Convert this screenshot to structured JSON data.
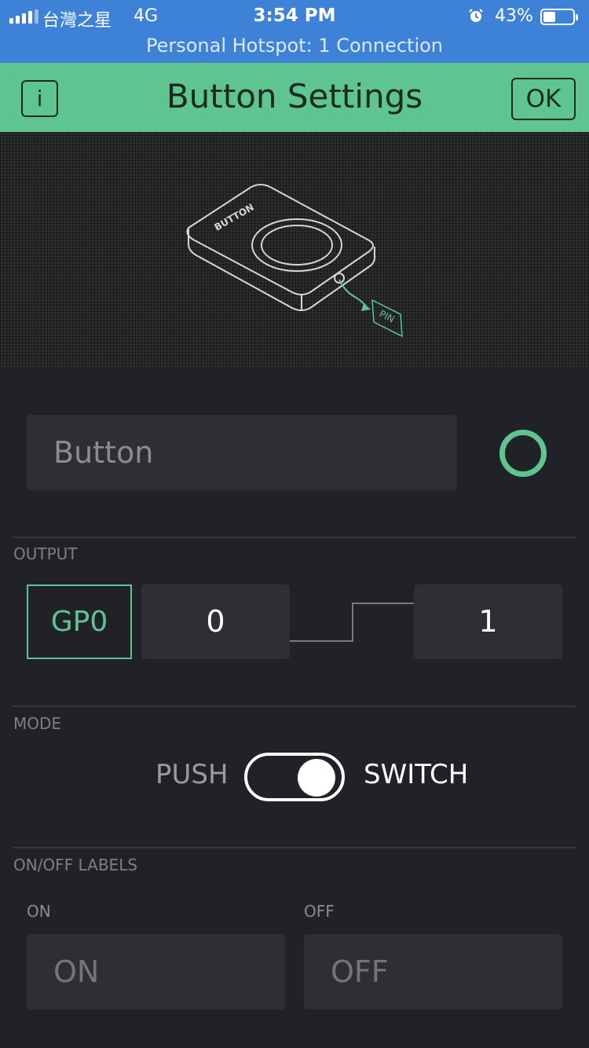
{
  "status_bar": {
    "carrier": "台灣之星",
    "network": "4G",
    "time": "3:54 PM",
    "battery_percent": "43%",
    "battery_level": 0.43,
    "hotspot": "Personal Hotspot: 1 Connection",
    "icons": [
      "signal-icon",
      "alarm-icon",
      "battery-icon"
    ]
  },
  "header": {
    "info_label": "i",
    "title": "Button Settings",
    "ok_label": "OK"
  },
  "illustration": {
    "device_label": "BUTTON",
    "pin_label": "PIN"
  },
  "widget": {
    "name_value": "Button",
    "accent_color": "#5fc590"
  },
  "output": {
    "section_label": "OUTPUT",
    "pin": "GP0",
    "low_value": "0",
    "high_value": "1"
  },
  "mode": {
    "section_label": "MODE",
    "option_push": "PUSH",
    "option_switch": "SWITCH",
    "selected": "SWITCH"
  },
  "labels": {
    "section_label": "ON/OFF LABELS",
    "on_caption": "ON",
    "on_value": "ON",
    "off_caption": "OFF",
    "off_value": "OFF"
  },
  "colors": {
    "status_bar": "#3d82d6",
    "header": "#5fc590",
    "background": "#212227",
    "field": "#2e2f34"
  }
}
